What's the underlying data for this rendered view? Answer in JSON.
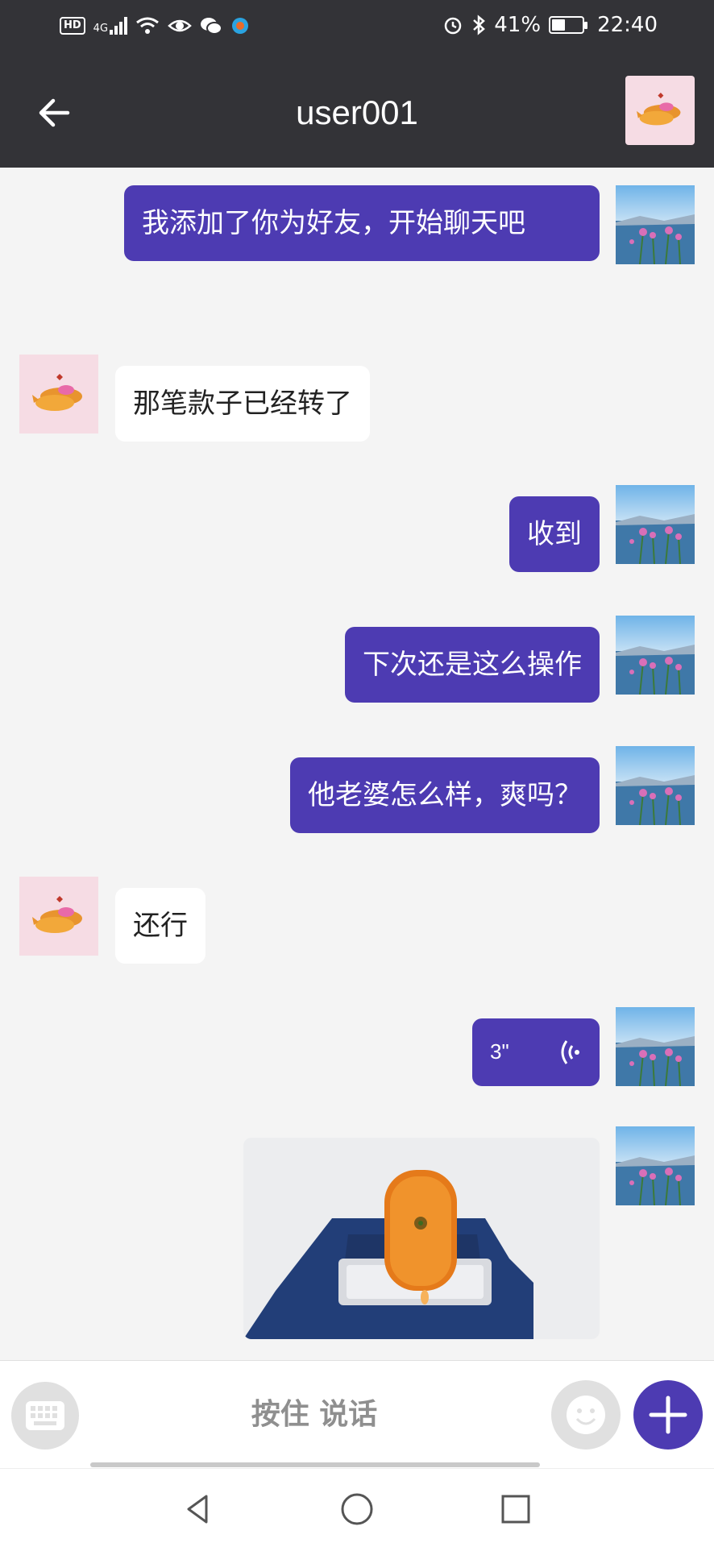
{
  "status_bar": {
    "hd": "HD",
    "network": "4G",
    "battery": "41%",
    "battery_level": 0.41,
    "time": "22:40"
  },
  "header": {
    "title": "user001"
  },
  "messages": [
    {
      "side": "out",
      "type": "text",
      "text": "我添加了你为好友，开始聊天吧"
    },
    {
      "side": "in",
      "type": "text",
      "text": "那笔款子已经转了"
    },
    {
      "side": "out",
      "type": "text",
      "text": "收到"
    },
    {
      "side": "out",
      "type": "text",
      "text": "下次还是这么操作"
    },
    {
      "side": "out",
      "type": "text",
      "text": "他老婆怎么样，爽吗？"
    },
    {
      "side": "in",
      "type": "text",
      "text": "还行"
    },
    {
      "side": "out",
      "type": "voice",
      "duration": "3\""
    },
    {
      "side": "out",
      "type": "image"
    }
  ],
  "input": {
    "talk_label": "按住 说话"
  },
  "colors": {
    "accent": "#4d3bb2",
    "header": "#333337",
    "background": "#f4f4f4",
    "incoming_bubble": "#ffffff"
  }
}
